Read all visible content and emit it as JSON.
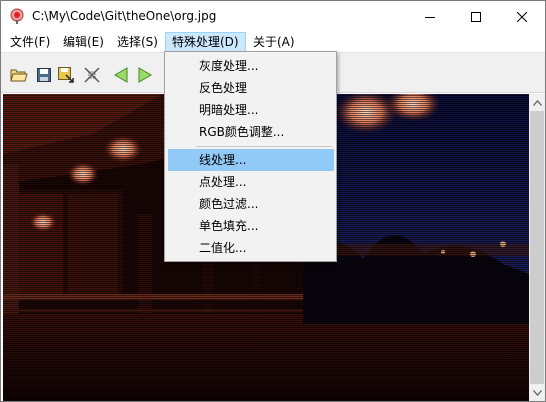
{
  "window": {
    "title": "C:\\My\\Code\\Git\\theOne\\org.jpg"
  },
  "menubar": {
    "items": [
      "文件(F)",
      "编辑(E)",
      "选择(S)",
      "特殊处理(D)",
      "关于(A)"
    ],
    "active_index": 3
  },
  "toolbar": {
    "icons": [
      "open-folder-icon",
      "save-icon",
      "save-as-icon",
      "transform-icon",
      "back-arrow-icon",
      "forward-arrow-icon"
    ]
  },
  "dropdown": {
    "group1": [
      "灰度处理...",
      "反色处理",
      "明暗处理...",
      "RGB颜色调整..."
    ],
    "group2": [
      "线处理...",
      "点处理...",
      "颜色过滤...",
      "单色填充...",
      "二值化..."
    ],
    "highlighted": "线处理..."
  },
  "colors": {
    "menu_highlight": "#91c9f7",
    "menubar_active": "#cce8ff",
    "toolbar_bg": "#f0f0f0",
    "arrow_green": "#7cc24a"
  }
}
